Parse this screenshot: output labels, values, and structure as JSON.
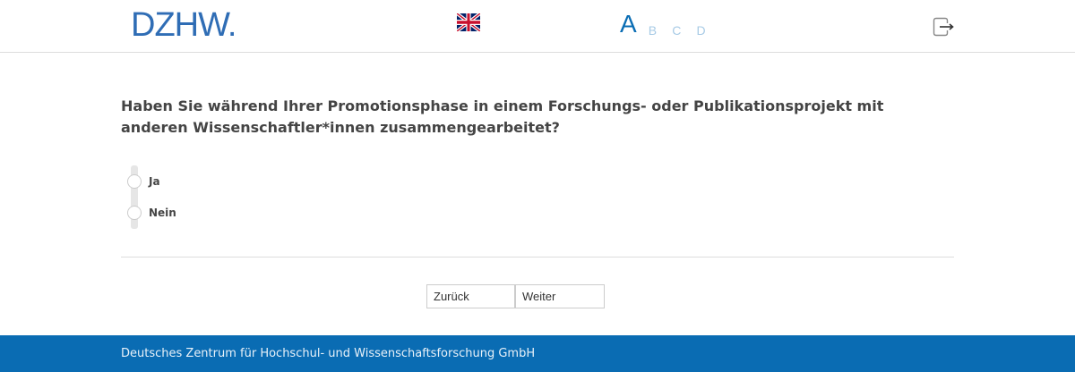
{
  "header": {
    "logo_text": "DZHW",
    "logo_dot": ".",
    "flag_icon": "uk-flag-icon",
    "languages": {
      "active": "A",
      "others": [
        "B",
        "C",
        "D"
      ]
    },
    "exit_icon": "exit-icon"
  },
  "question": {
    "text": "Haben Sie während Ihrer Promotionsphase in einem Forschungs- oder Publikationsprojekt mit anderen Wissenschaftler*innen zusammengearbeitet?"
  },
  "options": [
    {
      "label": "Ja"
    },
    {
      "label": "Nein"
    }
  ],
  "navigation": {
    "back_label": "Zurück",
    "next_label": "Weiter"
  },
  "footer": {
    "text": "Deutsches Zentrum für Hochschul- und Wissenschaftsforschung GmbH"
  },
  "colors": {
    "brand_blue": "#0a6cb3",
    "logo_blue": "#2f6db5"
  }
}
